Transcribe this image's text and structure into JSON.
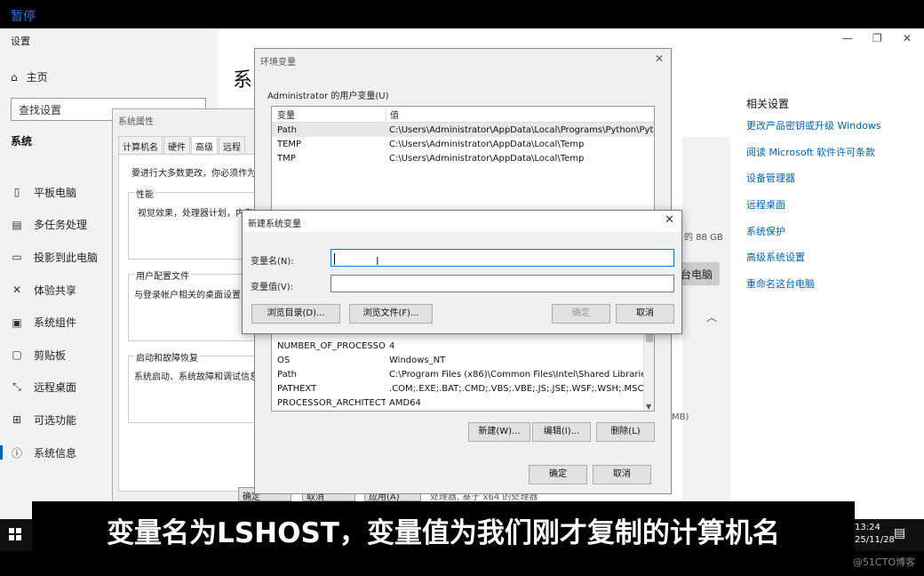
{
  "overlay": {
    "pause_label": "暂停"
  },
  "settings": {
    "window_title": "设置",
    "home_label": "主页",
    "search_placeholder": "查找设置",
    "section_title": "系统",
    "big_title": "系",
    "nav_items": [
      {
        "icon": "tablet-icon",
        "label": "平板电脑"
      },
      {
        "icon": "multitask-icon",
        "label": "多任务处理"
      },
      {
        "icon": "project-icon",
        "label": "投影到此电脑"
      },
      {
        "icon": "share-icon",
        "label": "体验共享"
      },
      {
        "icon": "components-icon",
        "label": "系统组件"
      },
      {
        "icon": "clipboard-icon",
        "label": "剪贴板"
      },
      {
        "icon": "remote-desktop-icon",
        "label": "远程桌面"
      },
      {
        "icon": "optional-features-icon",
        "label": "可选功能"
      },
      {
        "icon": "info-icon",
        "label": "系统信息"
      }
    ],
    "related_title": "相关设置",
    "related_links": [
      "更改产品密钥或升级 Windows",
      "阅读 Microsoft 软件许可条款",
      "设备管理器",
      "远程桌面",
      "系统保护",
      "高级系统设置",
      "重命名这台电脑"
    ],
    "ram_fragment": "的 88 GB",
    "mb_fragment": "MB)",
    "rename_button": "台电脑"
  },
  "sysprop": {
    "title": "系统属性",
    "tabs": [
      "计算机名",
      "硬件",
      "高级",
      "远程"
    ],
    "admin_note": "要进行大多数更改，你必须作为管",
    "performance_label": "性能",
    "performance_desc": "视觉效果，处理器计划，内存使用",
    "profile_label": "用户配置文件",
    "profile_desc": "与登录帐户相关的桌面设置",
    "startup_label": "启动和故障恢复",
    "startup_desc": "系统启动、系统故障和调试信息",
    "ok_button": "确定",
    "cancel_button": "取消",
    "apply_button": "应用(A)",
    "bottom_text": "处理器, 基于 x64 的处理器"
  },
  "env": {
    "title": "环境变量",
    "user_vars_label": "Administrator 的用户变量(U)",
    "col_var": "变量",
    "col_value": "值",
    "user_vars": [
      {
        "name": "Path",
        "value": "C:\\Users\\Administrator\\AppData\\Local\\Programs\\Python\\Pyt..."
      },
      {
        "name": "TEMP",
        "value": "C:\\Users\\Administrator\\AppData\\Local\\Temp"
      },
      {
        "name": "TMP",
        "value": "C:\\Users\\Administrator\\AppData\\Local\\Temp"
      }
    ],
    "system_vars": [
      {
        "name": "NUMBER_OF_PROCESSORS",
        "value": "4"
      },
      {
        "name": "OS",
        "value": "Windows_NT"
      },
      {
        "name": "Path",
        "value": "C:\\Program Files (x86)\\Common Files\\Intel\\Shared Libraries\\..."
      },
      {
        "name": "PATHEXT",
        "value": ".COM;.EXE;.BAT;.CMD;.VBS;.VBE;.JS;.JSE;.WSF;.WSH;.MSC"
      },
      {
        "name": "PROCESSOR_ARCHITECT...",
        "value": "AMD64"
      }
    ],
    "new_button": "新建(W)...",
    "edit_button": "编辑(I)...",
    "delete_button": "删除(L)",
    "ok_button": "确定",
    "cancel_button": "取消"
  },
  "newvar": {
    "title": "新建系统变量",
    "name_label": "变量名(N):",
    "name_value": "",
    "value_label": "变量值(V):",
    "value_value": "",
    "browse_dir_button": "浏览目录(D)...",
    "browse_file_button": "浏览文件(F)...",
    "ok_button": "确定",
    "cancel_button": "取消"
  },
  "subtitle": "变量名为LSHOST，变量值为我们刚才复制的计算机名",
  "taskbar": {
    "time": "13:24",
    "date": "25/11/28"
  },
  "watermark": "@51CTO博客"
}
